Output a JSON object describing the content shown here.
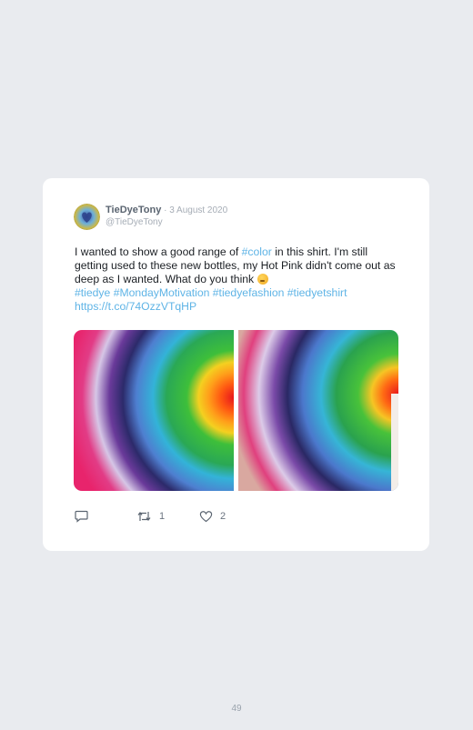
{
  "tweet": {
    "author_name": "TieDyeTony",
    "separator": " · ",
    "date": "3 August 2020",
    "handle": "@TieDyeTony",
    "text_part1": "I wanted to show a good range of ",
    "hashtag_color": "#color",
    "text_part2": " in this shirt. I'm still getting used to these new bottles, my Hot Pink didn't come out as deep as I wanted. What do you think ",
    "hashtags": [
      "#tiedye",
      "#MondayMotivation",
      "#tiedyefashion",
      "#tiedyetshirt"
    ],
    "link": "https://t.co/74OzzVTqHP",
    "retweet_count": "1",
    "like_count": "2"
  },
  "colors": {
    "page_background": "#e9ebef",
    "card_background": "#ffffff",
    "link_color": "#5fb4e6"
  },
  "icons": {
    "reply": "reply-icon",
    "retweet": "retweet-icon",
    "like": "heart-icon"
  },
  "page_number": "49"
}
